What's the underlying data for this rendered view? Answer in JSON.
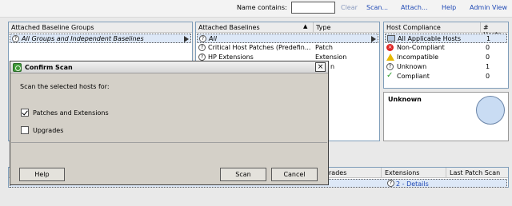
{
  "toolbar": {
    "name_contains_label": "Name contains:",
    "name_contains_value": "",
    "clear": "Clear",
    "scan": "Scan...",
    "attach": "Attach...",
    "help": "Help",
    "admin_view": "Admin View"
  },
  "groups_panel": {
    "header": "Attached Baseline Groups",
    "selected_row": "All Groups and Independent Baselines"
  },
  "baselines_panel": {
    "col_baselines": "Attached Baselines",
    "col_type": "Type",
    "rows": [
      {
        "name": "All",
        "type": ""
      },
      {
        "name": "Critical Host Patches (Predefin...",
        "type": "Patch"
      },
      {
        "name": "HP Extensions",
        "type": "Extension"
      },
      {
        "name": "",
        "type": "n"
      }
    ]
  },
  "compliance_panel": {
    "col_compliance": "Host Compliance",
    "col_hosts": "# Hosts",
    "rows": [
      {
        "label": "All Applicable Hosts",
        "count": "1",
        "icon": "hosts-icon"
      },
      {
        "label": "Non-Compliant",
        "count": "0",
        "icon": "error-icon"
      },
      {
        "label": "Incompatible",
        "count": "0",
        "icon": "warning-icon"
      },
      {
        "label": "Unknown",
        "count": "1",
        "icon": "question-icon"
      },
      {
        "label": "Compliant",
        "count": "0",
        "icon": "checkmark-icon"
      }
    ],
    "status_title": "Unknown"
  },
  "bottom_table": {
    "col_upgrades": "rades",
    "col_extensions": "Extensions",
    "col_last_patch": "Last Patch Scan ...",
    "extensions_value": "2 - Details"
  },
  "dialog": {
    "title": "Confirm Scan",
    "prompt": "Scan the selected hosts for:",
    "options": [
      {
        "label": "Patches and Extensions",
        "checked": true
      },
      {
        "label": "Upgrades",
        "checked": false
      }
    ],
    "help_label": "Help",
    "scan_label": "Scan",
    "cancel_label": "Cancel"
  },
  "colors": {
    "link": "#1f49b5",
    "dialog_bg": "#d4d0c8",
    "selection": "#dde8f7",
    "unknown_circle": "#c9dcf3"
  }
}
